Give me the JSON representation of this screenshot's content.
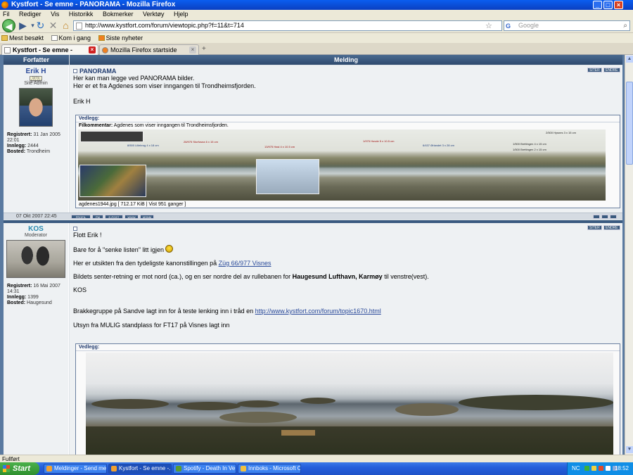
{
  "window": {
    "title": "Kystfort - Se emne - PANORAMA - Mozilla Firefox"
  },
  "menu": [
    "Fil",
    "Rediger",
    "Vis",
    "Historikk",
    "Bokmerker",
    "Verktøy",
    "Hjelp"
  ],
  "nav": {
    "url": "http://www.kystfort.com/forum/viewtopic.php?f=11&t=714",
    "search_placeholder": "Google"
  },
  "bookmarks": [
    "Mest besøkt",
    "Kom i gang",
    "Siste nyheter"
  ],
  "tabs": [
    {
      "label": "Kystfort - Se emne - PANORAMA",
      "active": true
    },
    {
      "label": "Mozilla Firefox startside",
      "active": false
    }
  ],
  "forum": {
    "header": {
      "author": "Forfatter",
      "message": "Melding"
    },
    "buttons": {
      "quote": "SITER",
      "edit": "ENDRE"
    },
    "posts": [
      {
        "author": "Erik H",
        "rank": "Site Admin",
        "rank_badge": "SITE ADMIN",
        "registered_label": "Registrert:",
        "registered": "31 Jan 2005 22:01",
        "posts_label": "Innlegg:",
        "posts": "2444",
        "location_label": "Bosted:",
        "location": "Trondheim",
        "title": "PANORAMA",
        "lines": [
          "Her kan man legge ved PANORAMA bilder.",
          "Her er et fra Agdenes som viser inngangen til Trondheimsfjorden.",
          "",
          "Erik H"
        ],
        "attachment_label": "Vedlegg:",
        "file_comment_label": "Filkommentar:",
        "file_comment": "Agdenes som viser inngangen til Trondheimsfjorden.",
        "image_labels": [
          "8/500 Lillebrug 4 x 18 cm",
          "28/975 Storfosna 6 x 15 cm",
          "13/975 Hasl 4 x 10.5 cm",
          "1/975 Hovde 5 x 10.5 cm",
          "6/437 Ørlandet 3 x 28 cm",
          "2/500 Hysnes 3 x 15 cm",
          "1/500 Brettingen 4 x 15 cm",
          "1/500 Brettingen 2 x 15 cm"
        ],
        "file_info": "agdenes1944.jpg [ 712.17 KiB | Vist 951 ganger ]",
        "date": "07 Okt 2007 22:45",
        "footer_buttons": [
          "PROFIL",
          "PM",
          "E-POST",
          "WWW",
          "MSNM"
        ]
      },
      {
        "author": "KOS",
        "rank": "Moderator",
        "registered_label": "Registrert:",
        "registered": "16 Mai 2007 14:31",
        "posts_label": "Innlegg:",
        "posts": "1399",
        "location_label": "Bosted:",
        "location": "Haugesund",
        "line1": "Flott Erik !",
        "line2": "Bare for å \"senke listen\" litt igjen",
        "line3_pre": "Her er utsikten fra den tydeligste kanonstillingen på ",
        "line3_link": "Züg 66/977 Visnes",
        "line4_pre": "Bildets senter-retning er mot nord (ca.), og en ser nordre del av rullebanen for ",
        "line4_bold": "Haugesund Lufthavn, Karmøy",
        "line4_post": " til venstre(vest).",
        "line5": "KOS",
        "line6_pre": "Brakkegruppe på Sandve lagt inn for å teste lenking inn i tråd en ",
        "line6_link": "http://www.kystfort.com/forum/topic1670.html",
        "line7": "Utsyn fra MULIG standplass for FT17 på Visnes lagt inn",
        "attachment_label": "Vedlegg:"
      }
    ]
  },
  "status": "Fullført",
  "taskbar": {
    "start": "Start",
    "tasks": [
      "Meldinger - Send mel...",
      "Kystfort - Se emne -...",
      "Spotify - Death In Ve...",
      "Innboks - Microsoft O..."
    ],
    "tray_lang": "NC",
    "clock": "18:52"
  }
}
